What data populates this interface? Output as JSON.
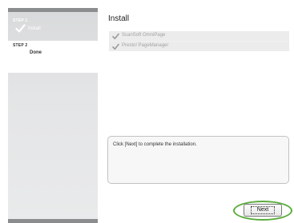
{
  "sidebar": {
    "steps": [
      {
        "number": "STEP 1",
        "label": "Install",
        "completed": true
      },
      {
        "number": "STEP 2",
        "label": "Done",
        "completed": false
      }
    ]
  },
  "main": {
    "title": "Install",
    "items": [
      {
        "label": "ScanSoft OmniPage",
        "checked": true
      },
      {
        "label": "Presto! PageManager",
        "checked": true
      }
    ],
    "message": "Click [Next] to complete the installation."
  },
  "footer": {
    "next_label": "Next"
  },
  "colors": {
    "highlight": "#5aac3e",
    "sidebar": "#e4e5e6",
    "bar": "#8a8c8e"
  }
}
